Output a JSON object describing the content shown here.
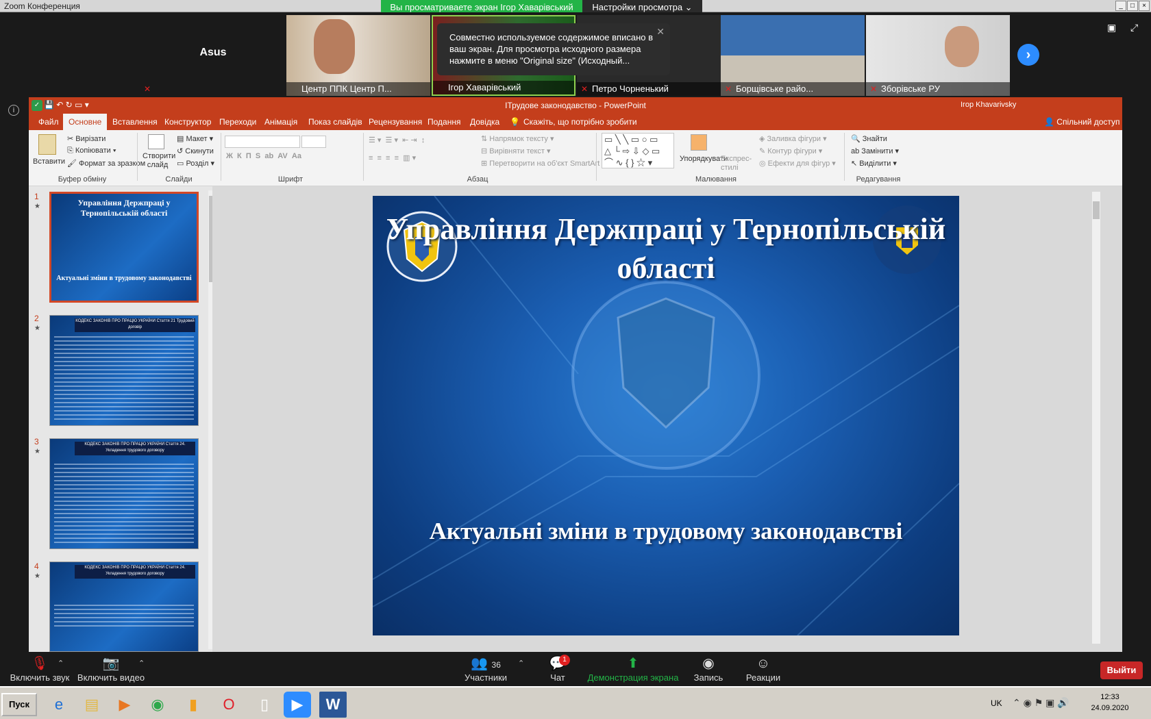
{
  "zoom": {
    "window_title": "Zoom Конференция",
    "share_banner": "Вы просматриваете экран Ігор Хаварівський",
    "view_options": "Настройки просмотра ⌄",
    "tooltip": "Совместно используемое содержимое вписано в ваш экран. Для просмотра исходного размера нажмите в меню \"Original size\" (Исходный...",
    "participants": [
      {
        "name": "Asus",
        "muted": true
      },
      {
        "name": "Центр ППК Центр П...",
        "muted": false
      },
      {
        "name": "Ігор Хаварівський",
        "muted": false
      },
      {
        "name": "Петро Чорненький",
        "muted": true
      },
      {
        "name": "Борщівське райо...",
        "muted": true
      },
      {
        "name": "Зборівське РУ",
        "muted": true
      }
    ],
    "toolbar": {
      "mute": "Включить звук",
      "video": "Включить видео",
      "participants": "Участники",
      "participants_count": "36",
      "chat": "Чат",
      "chat_badge": "1",
      "share": "Демонстрация экрана",
      "record": "Запись",
      "reactions": "Реакции",
      "leave": "Выйти"
    }
  },
  "ppt": {
    "title": "ІТрудове законодавство  -  PowerPoint",
    "user": "Ігор Khavarivsky",
    "share_label": "Спільний доступ",
    "tabs": [
      "Файл",
      "Основне",
      "Вставлення",
      "Конструктор",
      "Переходи",
      "Анімація",
      "Показ слайдів",
      "Рецензування",
      "Подання",
      "Довідка"
    ],
    "tell_me": "Скажіть, що потрібно зробити",
    "ribbon": {
      "paste": "Вставити",
      "cut": "Вирізати",
      "copy": "Копіювати",
      "format_painter": "Формат за зразком",
      "group_clipboard": "Буфер обміну",
      "new_slide": "Створити слайд",
      "layout": "Макет",
      "reset": "Скинути",
      "section": "Розділ",
      "group_slides": "Слайди",
      "group_font": "Шрифт",
      "text_direction": "Напрямок тексту",
      "align_text": "Вирівняти текст",
      "smartart": "Перетворити на об'єкт SmartArt",
      "group_paragraph": "Абзац",
      "arrange": "Упорядкувати",
      "quick_styles": "Експрес-стилі",
      "shape_fill": "Заливка фігури",
      "shape_outline": "Контур фігури",
      "shape_effects": "Ефекти для фігур",
      "group_drawing": "Малювання",
      "find": "Знайти",
      "replace": "Замінити",
      "select": "Виділити",
      "group_editing": "Редагування"
    },
    "thumbnails": [
      {
        "num": "1",
        "title": "Управління Держпраці у Тернопільській області",
        "subtitle": "Актуальні зміни в трудовому законодавстві"
      },
      {
        "num": "2",
        "title": "КОДЕКС ЗАКОНІВ ПРО ПРАЦЮ УКРАЇНИ Стаття 21 Трудовий договір"
      },
      {
        "num": "3",
        "title": "КОДЕКС ЗАКОНІВ ПРО ПРАЦЮ УКРАЇНИ Стаття 24. Укладення трудового договору"
      },
      {
        "num": "4",
        "title": "КОДЕКС ЗАКОНІВ ПРО ПРАЦЮ УКРАЇНИ Стаття 24. Укладення трудового договору"
      }
    ],
    "slide": {
      "title": "Управління Держпраці у Тернопільській області",
      "subtitle": "Актуальні зміни в трудовому законодавстві"
    }
  },
  "taskbar": {
    "start": "Пуск",
    "lang": "UK",
    "time": "12:33",
    "date": "24.09.2020"
  }
}
